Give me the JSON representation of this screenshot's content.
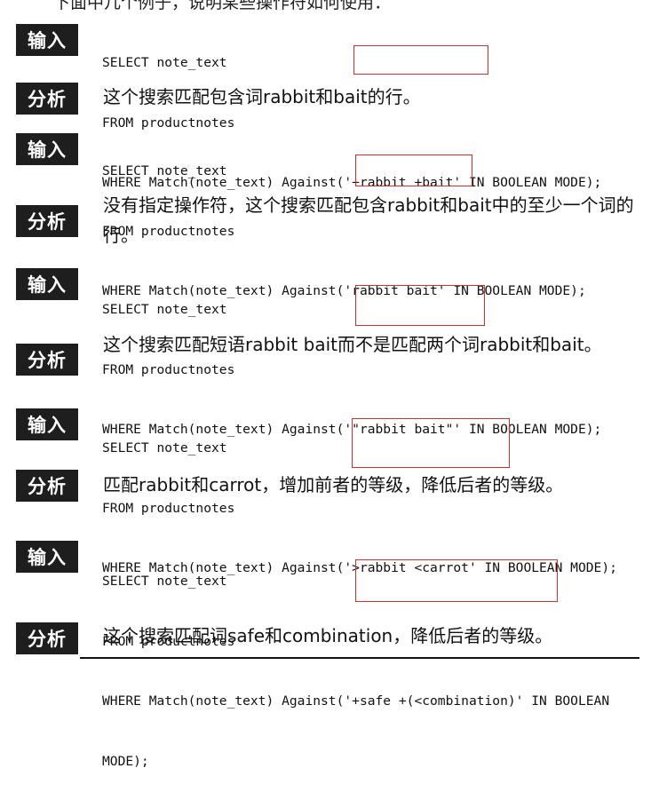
{
  "header_fragment": "下面中几个例子，说明某些操作符如何使用：",
  "labels": {
    "input": "输入",
    "analysis": "分析"
  },
  "blocks": [
    {
      "code": [
        "SELECT note_text",
        "FROM productnotes",
        "WHERE Match(note_text) Against('+rabbit +bait' IN BOOLEAN MODE);"
      ],
      "highlighted": "'+rabbit +bait'",
      "analysis": "这个搜索匹配包含词rabbit和bait的行。"
    },
    {
      "code": [
        "SELECT note_text",
        "FROM productnotes",
        "WHERE Match(note_text) Against('rabbit bait' IN BOOLEAN MODE);"
      ],
      "highlighted": "'rabbit bait'",
      "analysis": "没有指定操作符，这个搜索匹配包含rabbit和bait中的至少一个词的行。"
    },
    {
      "code": [
        "SELECT note_text",
        "FROM productnotes",
        "WHERE Match(note_text) Against('\"rabbit bait\"' IN BOOLEAN MODE);"
      ],
      "highlighted": "'\"rabbit bait\"'",
      "analysis": "这个搜索匹配短语rabbit bait而不是匹配两个词rabbit和bait。"
    },
    {
      "code": [
        "SELECT note_text",
        "FROM productnotes",
        "WHERE Match(note_text) Against('>rabbit <carrot' IN BOOLEAN MODE);"
      ],
      "highlighted": "'>rabbit <carrot'",
      "analysis": "匹配rabbit和carrot，增加前者的等级，降低后者的等级。"
    },
    {
      "code": [
        "SELECT note_text",
        "FROM productnotes",
        "WHERE Match(note_text) Against('+safe +(<combination)' IN BOOLEAN",
        "MODE);"
      ],
      "highlighted": "'+safe +(<combination)'",
      "analysis": "这个搜索匹配词safe和combination，降低后者的等级。"
    }
  ]
}
